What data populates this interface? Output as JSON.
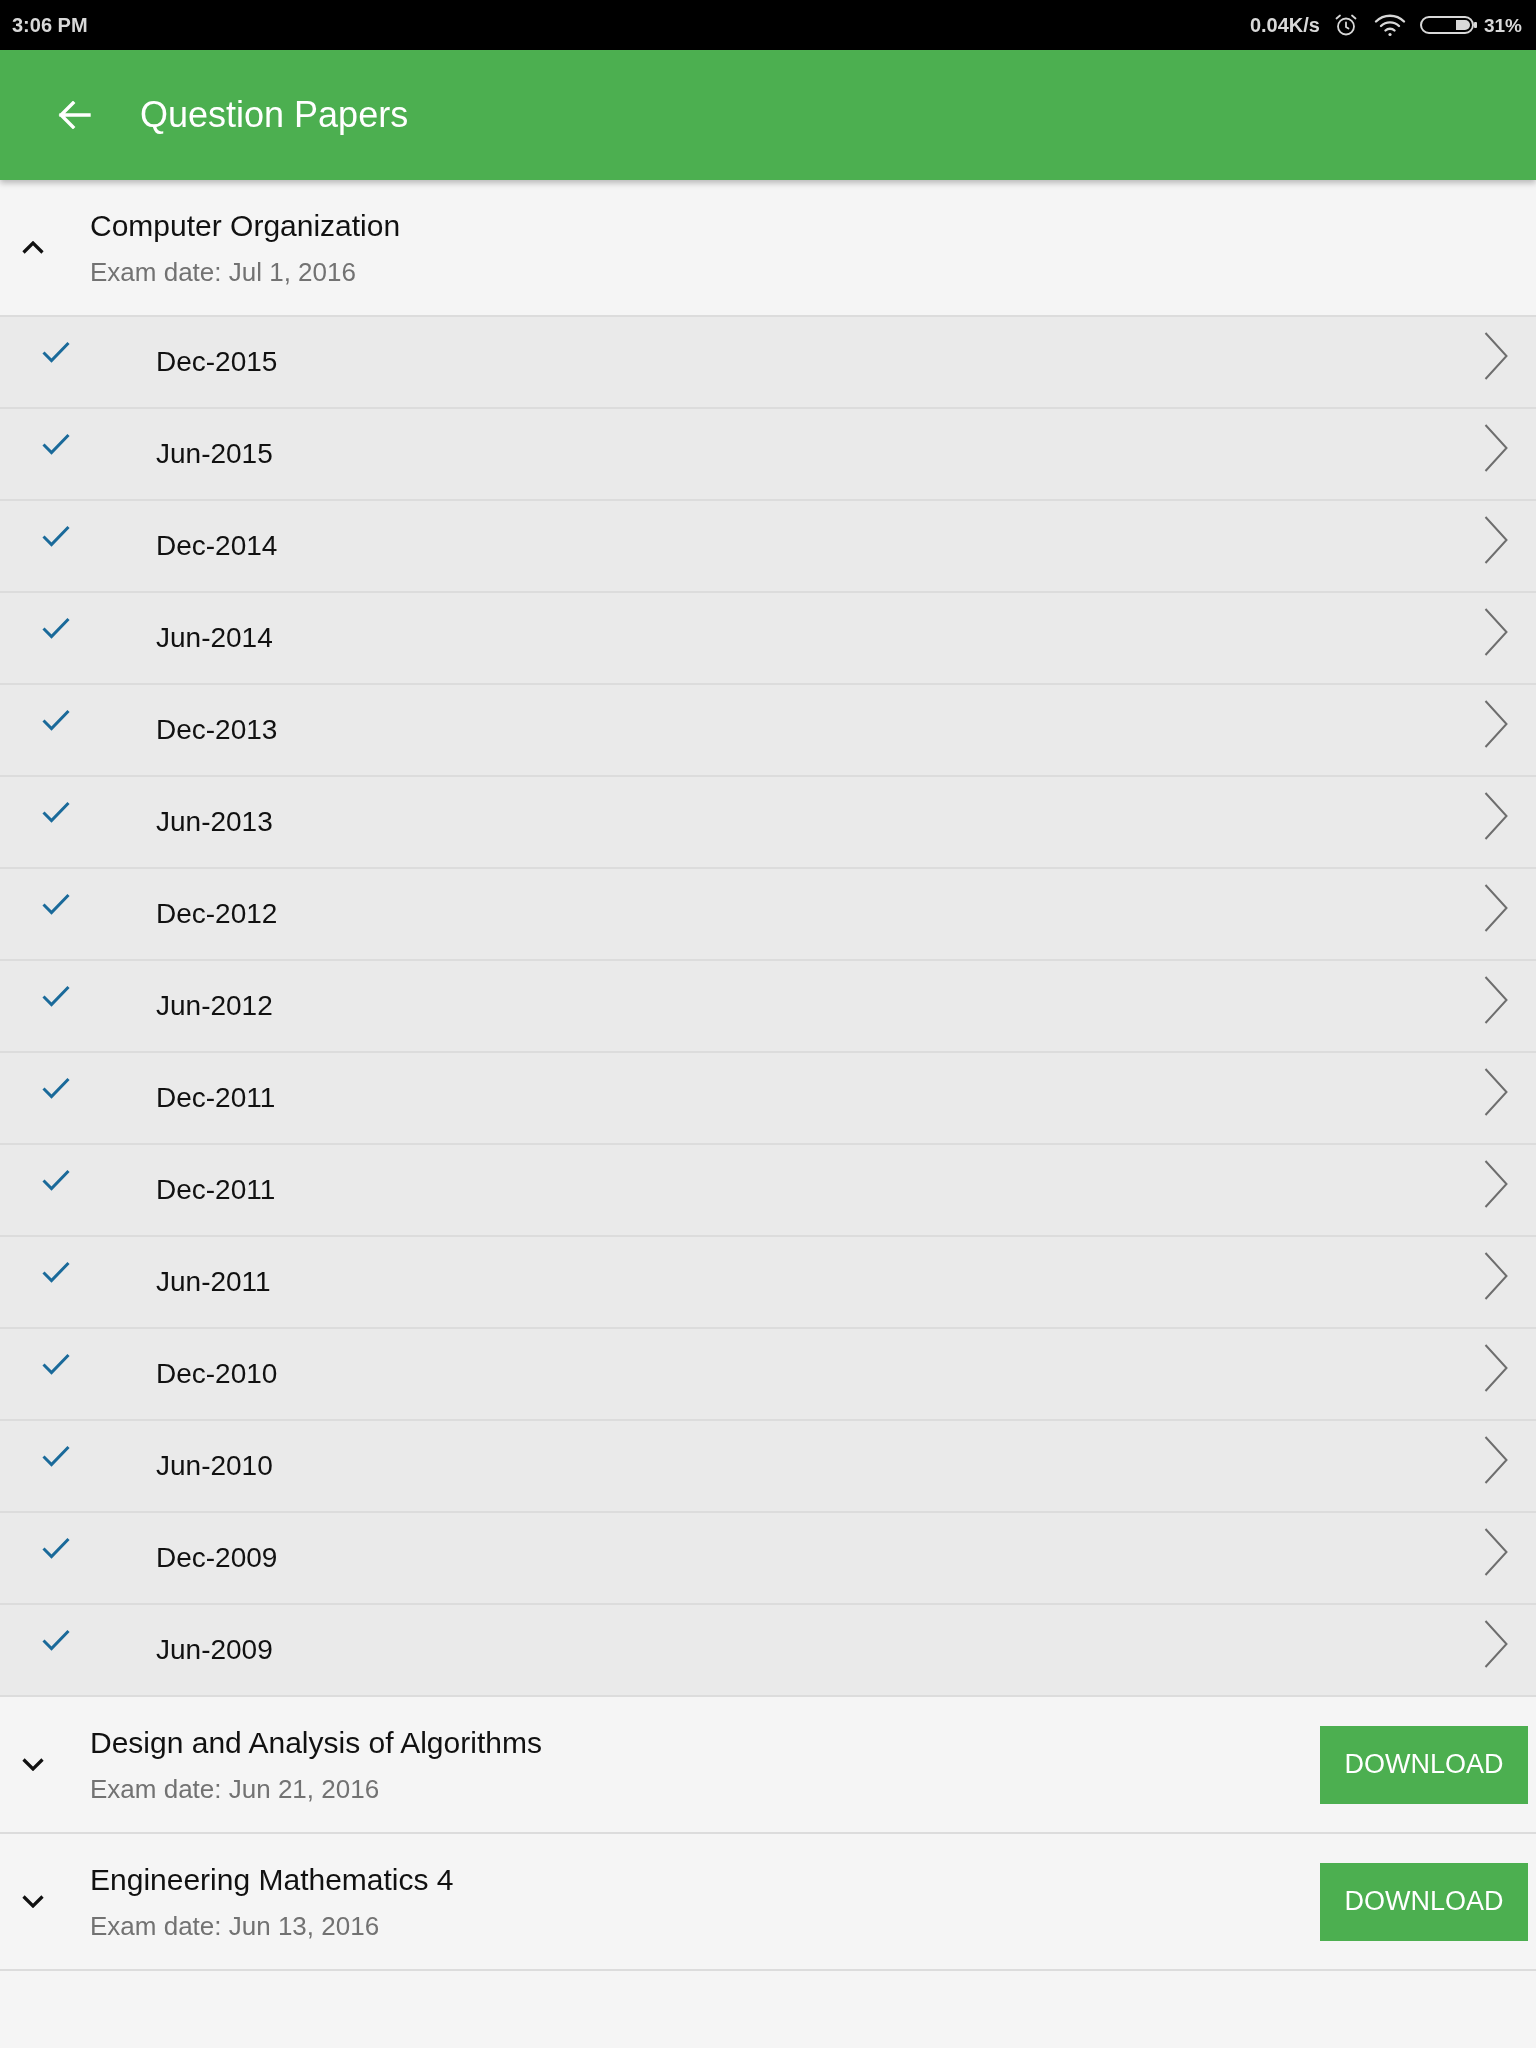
{
  "status_bar": {
    "time": "3:06 PM",
    "network_speed": "0.04K/s",
    "battery": "31%"
  },
  "app_bar": {
    "title": "Question Papers"
  },
  "subjects": [
    {
      "title": "Computer Organization",
      "exam_date": "Exam date: Jul 1, 2016",
      "expanded": true,
      "papers": [
        {
          "label": "Dec-2015",
          "checked": true
        },
        {
          "label": "Jun-2015",
          "checked": true
        },
        {
          "label": "Dec-2014",
          "checked": true
        },
        {
          "label": "Jun-2014",
          "checked": true
        },
        {
          "label": "Dec-2013",
          "checked": true
        },
        {
          "label": "Jun-2013",
          "checked": true
        },
        {
          "label": "Dec-2012",
          "checked": true
        },
        {
          "label": "Jun-2012",
          "checked": true
        },
        {
          "label": "Dec-2011",
          "checked": true
        },
        {
          "label": "Dec-2011",
          "checked": true
        },
        {
          "label": "Jun-2011",
          "checked": true
        },
        {
          "label": "Dec-2010",
          "checked": true
        },
        {
          "label": "Jun-2010",
          "checked": true
        },
        {
          "label": "Dec-2009",
          "checked": true
        },
        {
          "label": "Jun-2009",
          "checked": true
        }
      ]
    },
    {
      "title": "Design and Analysis of Algorithms",
      "exam_date": "Exam date: Jun 21, 2016",
      "expanded": false,
      "action": "DOWNLOAD"
    },
    {
      "title": "Engineering Mathematics 4",
      "exam_date": "Exam date: Jun 13, 2016",
      "expanded": false,
      "action": "DOWNLOAD"
    }
  ]
}
